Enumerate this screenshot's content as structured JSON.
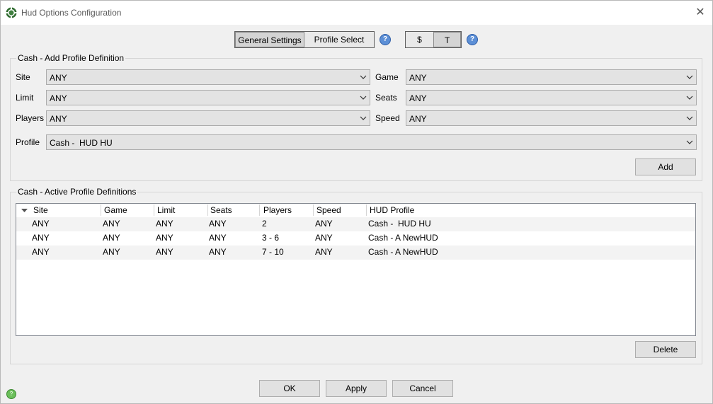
{
  "window": {
    "title": "Hud Options Configuration"
  },
  "tabs": {
    "general": "General Settings",
    "profile": "Profile Select"
  },
  "mode": {
    "cash": "$",
    "tourney": "T"
  },
  "add_group": {
    "title": "Cash - Add Profile Definition",
    "site_label": "Site",
    "site_value": "ANY",
    "game_label": "Game",
    "game_value": "ANY",
    "limit_label": "Limit",
    "limit_value": "ANY",
    "seats_label": "Seats",
    "seats_value": "ANY",
    "players_label": "Players",
    "players_value": "ANY",
    "speed_label": "Speed",
    "speed_value": "ANY",
    "profile_label": "Profile",
    "profile_value": "Cash -  HUD HU",
    "add_label": "Add"
  },
  "active_group": {
    "title": "Cash - Active Profile Definitions",
    "columns": [
      "Site",
      "Game",
      "Limit",
      "Seats",
      "Players",
      "Speed",
      "HUD Profile"
    ],
    "rows": [
      [
        "ANY",
        "ANY",
        "ANY",
        "ANY",
        "2",
        "ANY",
        "Cash -  HUD HU"
      ],
      [
        "ANY",
        "ANY",
        "ANY",
        "ANY",
        "3 - 6",
        "ANY",
        "Cash - A NewHUD"
      ],
      [
        "ANY",
        "ANY",
        "ANY",
        "ANY",
        "7 - 10",
        "ANY",
        "Cash - A NewHUD"
      ]
    ],
    "delete_label": "Delete"
  },
  "footer": {
    "ok": "OK",
    "apply": "Apply",
    "cancel": "Cancel"
  },
  "colors": {
    "help_blue": "#5c8fd6",
    "app_green": "#3f7f3f"
  },
  "icons": [
    "app-icon",
    "close-icon",
    "help-icon",
    "chevron-down-icon",
    "sort-icon",
    "status-icon"
  ]
}
